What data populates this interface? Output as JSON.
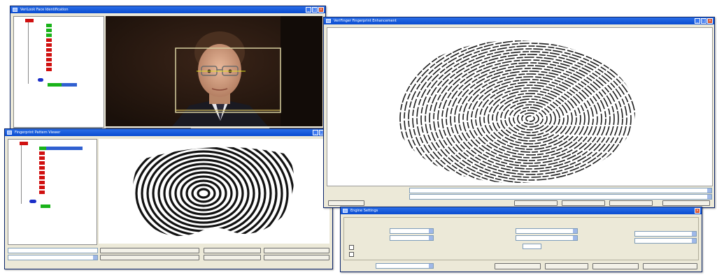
{
  "windows": {
    "face": {
      "title": "VeriLook Face Identification"
    },
    "fpColor": {
      "title": "VeriFinger Fingerprint Enhancement"
    },
    "fpMono": {
      "title": "Fingerprint Pattern Viewer"
    },
    "settings": {
      "title": "Engine Settings"
    }
  },
  "colors": {
    "accent": "#0a4cd0",
    "red_node": "#d01010",
    "green_node": "#19b319",
    "blue_node": "#1a2ec8"
  }
}
